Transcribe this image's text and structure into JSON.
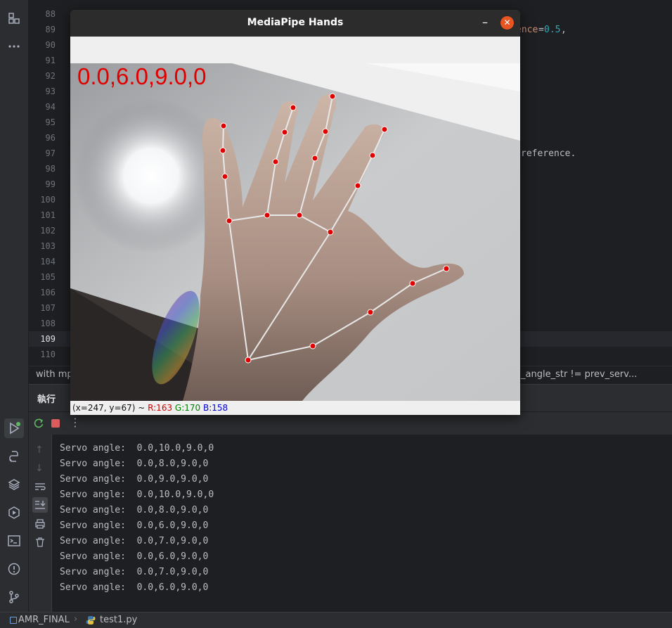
{
  "editor": {
    "line_numbers": [
      "88",
      "89",
      "90",
      "91",
      "92",
      "93",
      "94",
      "95",
      "96",
      "97",
      "98",
      "99",
      "100",
      "101",
      "102",
      "103",
      "104",
      "105",
      "106",
      "107",
      "108",
      "109",
      "110"
    ],
    "current_line": "109",
    "code_fragment_89a": "ence",
    "code_fragment_89b": "=",
    "code_fragment_89c": "0.5",
    "code_fragment_89d": ",",
    "code_fragment_97": "reference.",
    "breadcrumb_left": "with mp",
    "breadcrumb_right": "_angle_str != prev_serv..."
  },
  "run_panel": {
    "tab_label": "執行",
    "console_lines": [
      "Servo angle:  0.0,10.0,9.0,0",
      "Servo angle:  0.0,8.0,9.0,0",
      "Servo angle:  0.0,9.0,9.0,0",
      "Servo angle:  0.0,10.0,9.0,0",
      "Servo angle:  0.0,8.0,9.0,0",
      "Servo angle:  0.0,6.0,9.0,0",
      "Servo angle:  0.0,7.0,9.0,0",
      "Servo angle:  0.0,6.0,9.0,0",
      "Servo angle:  0.0,7.0,9.0,0",
      "Servo angle:  0.0,6.0,9.0,0"
    ]
  },
  "status_bar": {
    "project": "AMR_FINAL",
    "file": "test1.py"
  },
  "mediapipe_window": {
    "title": "MediaPipe Hands",
    "minimize_glyph": "–",
    "close_glyph": "✕",
    "overlay_text": "0.0,6.0,9.0,0",
    "pixel_info": {
      "coords": "(x=247, y=67) ~ ",
      "r": "R:163",
      "g": "G:170",
      "b": "B:158"
    }
  },
  "colors": {
    "accent_red": "#e00000",
    "close_button": "#e95420",
    "landmark": "#e00000",
    "connector": "#e8e8e8"
  }
}
